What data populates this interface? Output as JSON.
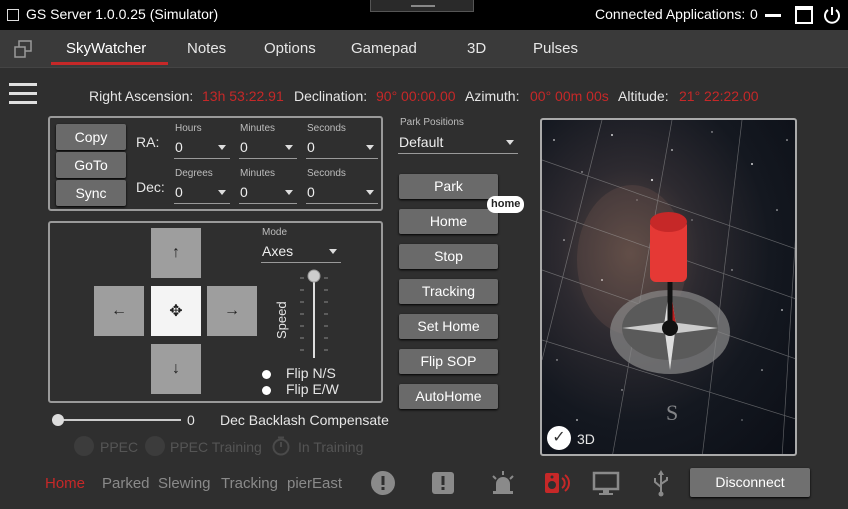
{
  "titlebar": {
    "app_title": "GS Server 1.0.0.25 (Simulator)",
    "connected_label": "Connected Applications:",
    "connected_count": "0"
  },
  "tabs": [
    {
      "label": "SkyWatcher"
    },
    {
      "label": "Notes"
    },
    {
      "label": "Options"
    },
    {
      "label": "Gamepad"
    },
    {
      "label": "3D"
    },
    {
      "label": "Pulses"
    }
  ],
  "coords": {
    "ra_label": "Right Ascension:",
    "ra_value": "13h 53:22.91",
    "dec_label": "Declination:",
    "dec_value": "90° 00:00.00",
    "az_label": "Azimuth:",
    "az_value": "00° 00m 00s",
    "alt_label": "Altitude:",
    "alt_value": "21° 22:22.00"
  },
  "goto": {
    "copy_label": "Copy",
    "goto_label": "GoTo",
    "sync_label": "Sync",
    "ra_label": "RA:",
    "dec_label": "Dec:",
    "hours_label": "Hours",
    "minutes_label": "Minutes",
    "seconds_label": "Seconds",
    "degrees_label": "Degrees",
    "ra_hours": "0",
    "ra_minutes": "0",
    "ra_seconds": "0",
    "dec_degrees": "0",
    "dec_minutes": "0",
    "dec_seconds": "0"
  },
  "motion": {
    "mode_label": "Mode",
    "mode_value": "Axes",
    "speed_label": "Speed",
    "speed_level": 1.0,
    "flip_ns_label": "Flip N/S",
    "flip_ew_label": "Flip E/W"
  },
  "backlash": {
    "value": "0",
    "label": "Dec Backlash Compensate"
  },
  "ppec": {
    "ppec_label": "PPEC",
    "training_label": "PPEC Training",
    "in_training_label": "In Training"
  },
  "park": {
    "positions_label": "Park Positions",
    "positions_value": "Default",
    "buttons": [
      "Park",
      "Home",
      "Stop",
      "Tracking",
      "Set Home",
      "Flip SOP",
      "AutoHome"
    ],
    "home_badge": "home"
  },
  "view3d": {
    "checkbox_label": "3D"
  },
  "status": {
    "home": "Home",
    "parked": "Parked",
    "slewing": "Slewing",
    "tracking": "Tracking",
    "pier": "pierEast",
    "disconnect_label": "Disconnect",
    "accent": "#c62828"
  }
}
